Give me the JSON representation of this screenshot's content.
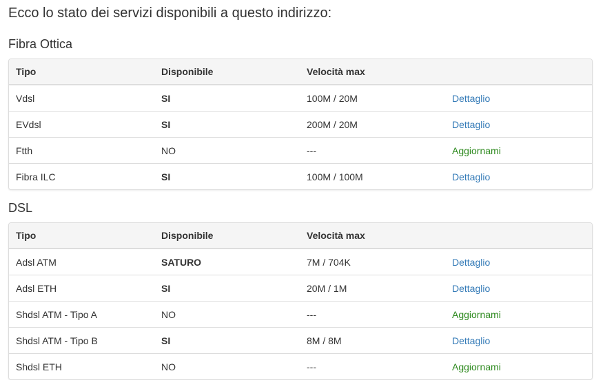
{
  "intro": "Ecco lo stato dei servizi disponibili a questo indirizzo:",
  "colors": {
    "link": "#337ab7",
    "update": "#2e8a1f",
    "text": "#333333"
  },
  "sections": [
    {
      "title": "Fibra Ottica",
      "headers": [
        "Tipo",
        "Disponibile",
        "Velocità max",
        ""
      ],
      "rows": [
        {
          "tipo": "Vdsl",
          "disponibile": "SI",
          "bold": true,
          "velocita": "100M / 20M",
          "action": "Dettaglio",
          "action_type": "link"
        },
        {
          "tipo": "EVdsl",
          "disponibile": "SI",
          "bold": true,
          "velocita": "200M / 20M",
          "action": "Dettaglio",
          "action_type": "link"
        },
        {
          "tipo": "Ftth",
          "disponibile": "NO",
          "bold": false,
          "velocita": "---",
          "action": "Aggiornami",
          "action_type": "update"
        },
        {
          "tipo": "Fibra ILC",
          "disponibile": "SI",
          "bold": true,
          "velocita": "100M / 100M",
          "action": "Dettaglio",
          "action_type": "link"
        }
      ]
    },
    {
      "title": "DSL",
      "headers": [
        "Tipo",
        "Disponibile",
        "Velocità max",
        ""
      ],
      "rows": [
        {
          "tipo": "Adsl ATM",
          "disponibile": "SATURO",
          "bold": true,
          "velocita": "7M / 704K",
          "action": "Dettaglio",
          "action_type": "link"
        },
        {
          "tipo": "Adsl ETH",
          "disponibile": "SI",
          "bold": true,
          "velocita": "20M / 1M",
          "action": "Dettaglio",
          "action_type": "link"
        },
        {
          "tipo": "Shdsl ATM - Tipo A",
          "disponibile": "NO",
          "bold": false,
          "velocita": "---",
          "action": "Aggiornami",
          "action_type": "update"
        },
        {
          "tipo": "Shdsl ATM - Tipo B",
          "disponibile": "SI",
          "bold": true,
          "velocita": "8M / 8M",
          "action": "Dettaglio",
          "action_type": "link"
        },
        {
          "tipo": "Shdsl ETH",
          "disponibile": "NO",
          "bold": false,
          "velocita": "---",
          "action": "Aggiornami",
          "action_type": "update"
        }
      ]
    }
  ]
}
